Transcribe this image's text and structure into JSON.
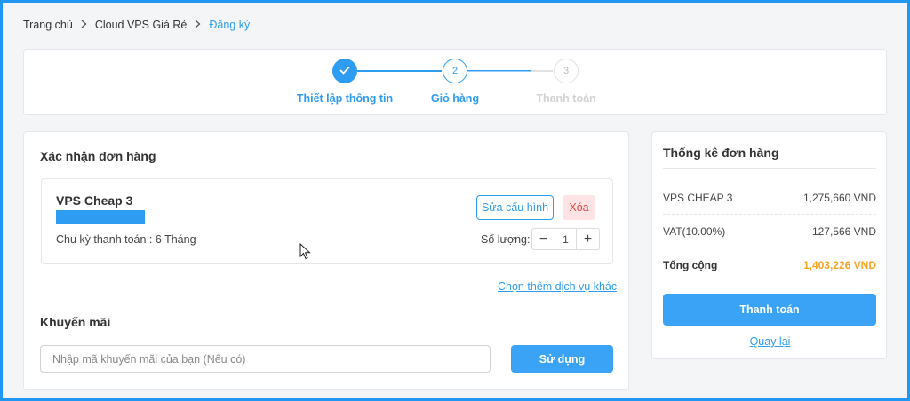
{
  "breadcrumb": {
    "items": [
      "Trang chủ",
      "Cloud VPS Giá Rẻ",
      "Đăng ký"
    ]
  },
  "steps": [
    {
      "number": "",
      "label": "Thiết lập thông tin",
      "state": "done"
    },
    {
      "number": "2",
      "label": "Giỏ hàng",
      "state": "active"
    },
    {
      "number": "3",
      "label": "Thanh toán",
      "state": "todo"
    }
  ],
  "order": {
    "title": "Xác nhận đơn hàng",
    "item_name": "VPS Cheap 3",
    "cycle": "Chu kỳ thanh toán : 6 Tháng",
    "edit_label": "Sửa cấu hình",
    "delete_label": "Xóa",
    "qty_label": "Số lượng:",
    "qty_value": "1",
    "minus": "−",
    "plus": "+",
    "more_link": "Chọn thêm dịch vụ khác"
  },
  "promo": {
    "title": "Khuyến mãi",
    "placeholder": "Nhập mã khuyến mãi của bạn (Nếu có)",
    "use_label": "Sử dụng"
  },
  "summary": {
    "title": "Thống kê đơn hàng",
    "rows": [
      {
        "label": "VPS CHEAP 3",
        "value": "1,275,660 VND"
      },
      {
        "label": "VAT(10.00%)",
        "value": "127,566 VND"
      }
    ],
    "total_label": "Tổng cộng",
    "total_value": "1,403,226 VND",
    "pay_label": "Thanh toán",
    "back_label": "Quay lại"
  },
  "colors": {
    "accent": "#2e9cf0",
    "total": "#f5a524",
    "delete_bg": "#fde3e3",
    "frame": "#2196f3"
  },
  "icons": [
    "chevron-right-icon",
    "check-icon",
    "mouse-cursor-icon"
  ]
}
